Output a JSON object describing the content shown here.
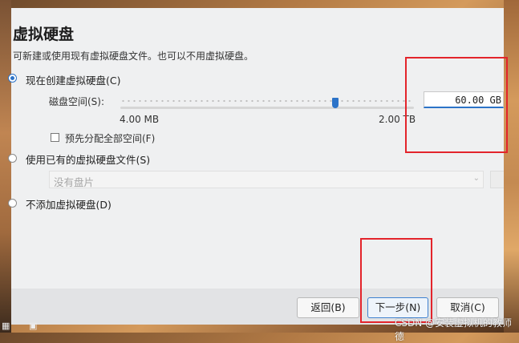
{
  "dialog": {
    "title": "虚拟硬盘",
    "description": "可新建或使用现有虚拟硬盘文件。也可以不用虚拟硬盘。",
    "options": {
      "create_new": "现在创建虚拟硬盘(C)",
      "use_existing": "使用已有的虚拟硬盘文件(S)",
      "no_disk": "不添加虚拟硬盘(D)"
    },
    "selected_option": "create_new",
    "disk_size_label": "磁盘空间(S):",
    "disk_size_value": "60.00 GB",
    "slider_min_label": "4.00 MB",
    "slider_max_label": "2.00 TB",
    "preallocate_label": "预先分配全部空间(F)",
    "preallocate_checked": false,
    "existing_disk_placeholder": "没有盘片"
  },
  "buttons": {
    "back": "返回(B)",
    "next": "下一步(N)",
    "cancel": "取消(C)"
  },
  "watermark": "CSDN @安装虚拟机的教师德",
  "colors": {
    "accent": "#2c73c8",
    "highlight_box": "#e3242b"
  }
}
